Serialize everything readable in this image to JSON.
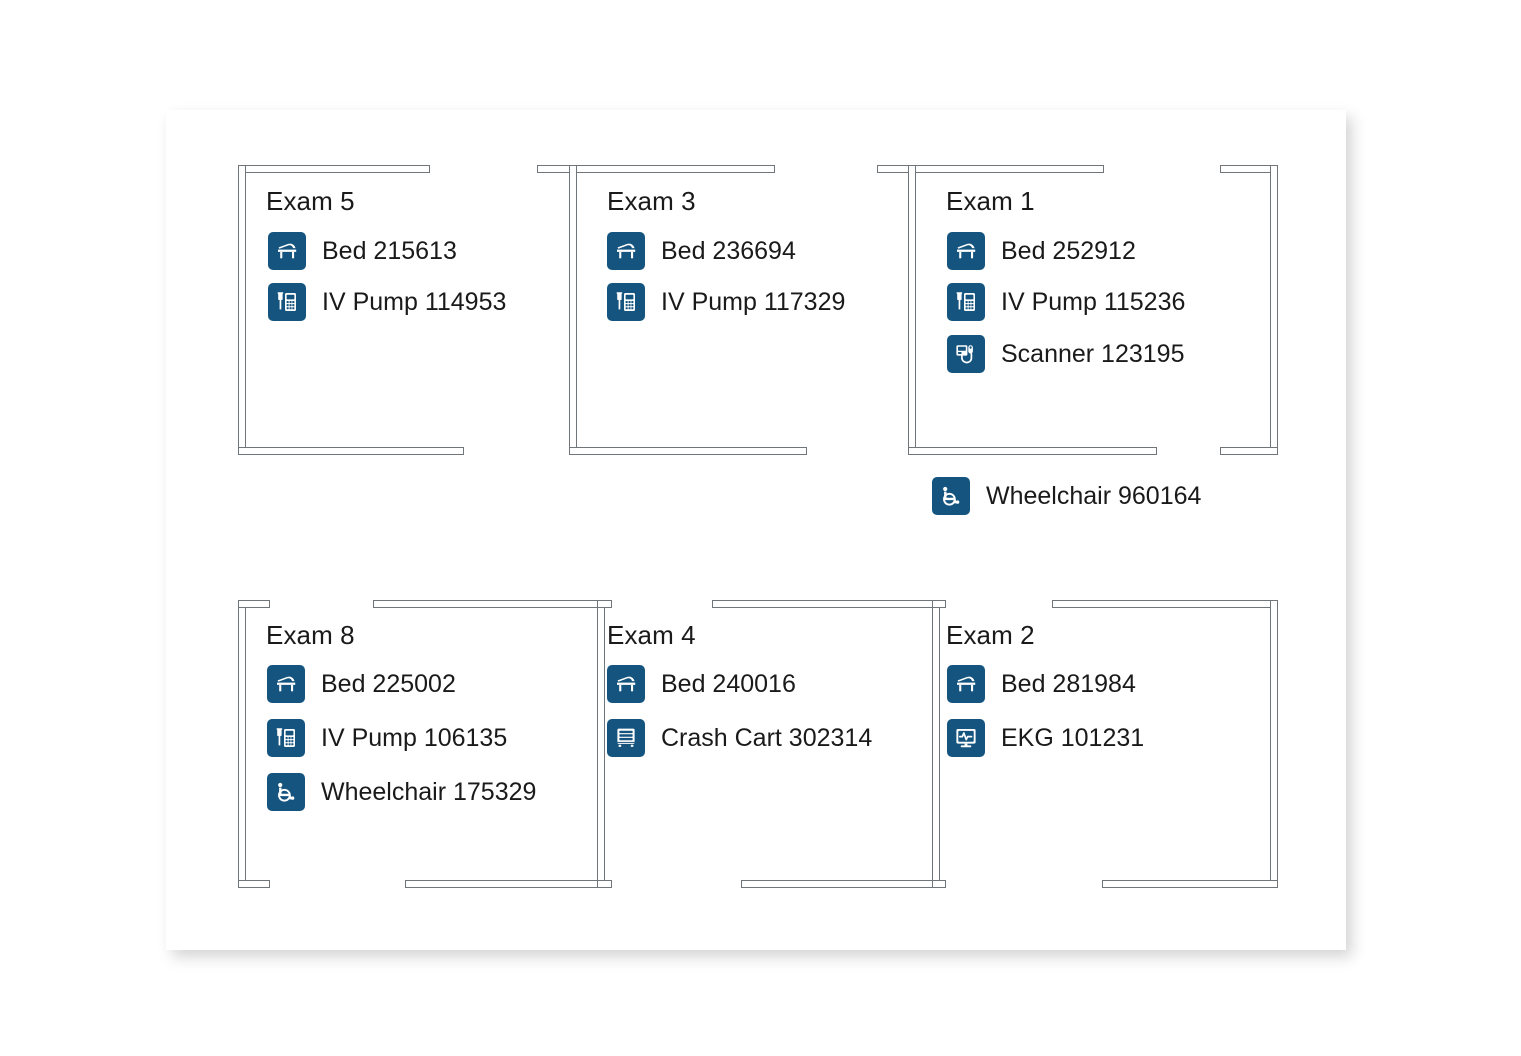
{
  "plan": {
    "background_color": "#ffffff",
    "card_color": "#ffffff",
    "wall_stroke_color": "#70757a",
    "icon_color": "#15547f",
    "text_color": "#1a1a1a"
  },
  "rooms": [
    {
      "id": "exam-5",
      "title": "Exam 5",
      "assets": [
        {
          "icon": "bed-icon",
          "label": "Bed 215613"
        },
        {
          "icon": "iv-pump-icon",
          "label": "IV Pump 114953"
        }
      ]
    },
    {
      "id": "exam-3",
      "title": "Exam 3",
      "assets": [
        {
          "icon": "bed-icon",
          "label": "Bed 236694"
        },
        {
          "icon": "iv-pump-icon",
          "label": "IV Pump 117329"
        }
      ]
    },
    {
      "id": "exam-1",
      "title": "Exam 1",
      "assets": [
        {
          "icon": "bed-icon",
          "label": "Bed 252912"
        },
        {
          "icon": "iv-pump-icon",
          "label": "IV Pump 115236"
        },
        {
          "icon": "scanner-icon",
          "label": "Scanner 123195"
        }
      ]
    },
    {
      "id": "exam-8",
      "title": "Exam 8",
      "assets": [
        {
          "icon": "bed-icon",
          "label": "Bed 225002"
        },
        {
          "icon": "iv-pump-icon",
          "label": "IV Pump 106135"
        },
        {
          "icon": "wheelchair-icon",
          "label": "Wheelchair 175329"
        }
      ]
    },
    {
      "id": "exam-4",
      "title": "Exam 4",
      "assets": [
        {
          "icon": "bed-icon",
          "label": "Bed 240016"
        },
        {
          "icon": "crash-cart-icon",
          "label": "Crash Cart 302314"
        }
      ]
    },
    {
      "id": "exam-2",
      "title": "Exam 2",
      "assets": [
        {
          "icon": "bed-icon",
          "label": "Bed 281984"
        },
        {
          "icon": "ekg-icon",
          "label": "EKG 101231"
        }
      ]
    }
  ],
  "corridor_assets": [
    {
      "icon": "wheelchair-icon",
      "label": "Wheelchair 960164"
    }
  ]
}
